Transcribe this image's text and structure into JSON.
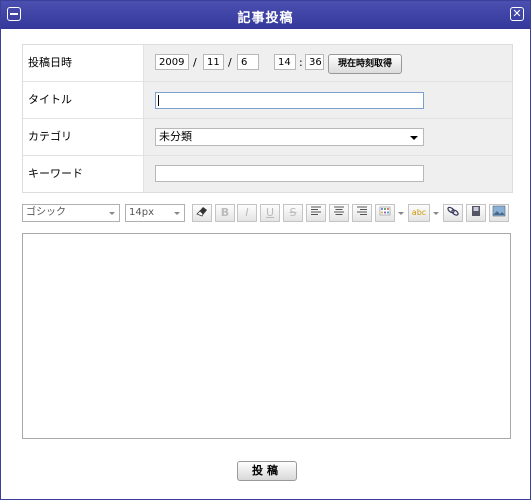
{
  "window": {
    "title": "記事投稿"
  },
  "form": {
    "datetime": {
      "label": "投稿日時",
      "year": "2009",
      "month": "11",
      "day": "6",
      "hour": "14",
      "minute": "36",
      "date_sep": "/",
      "time_sep": ":",
      "now_button": "現在時刻取得"
    },
    "title": {
      "label": "タイトル",
      "value": ""
    },
    "category": {
      "label": "カテゴリ",
      "selected": "未分類"
    },
    "keyword": {
      "label": "キーワード",
      "value": ""
    }
  },
  "toolbar": {
    "font_family": "ゴシック",
    "font_size": "14px",
    "buttons": {
      "bold": "B",
      "italic": "I",
      "underline": "U",
      "strike": "S",
      "spellcheck": "abc"
    }
  },
  "editor": {
    "content": ""
  },
  "submit_label": "投稿"
}
